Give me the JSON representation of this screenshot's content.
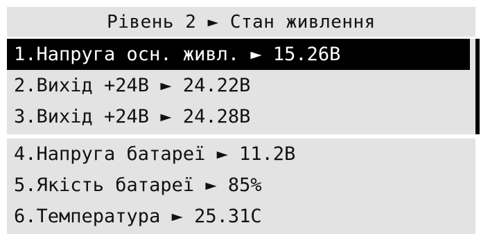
{
  "header": {
    "title": "Рівень 2 ► Стан живлення"
  },
  "menu": {
    "items": [
      {
        "label": "1.Напруга осн. живл. ► 15.26В",
        "selected": true
      },
      {
        "label": "2.Вихід +24В ► 24.22В",
        "selected": false
      },
      {
        "label": "3.Вихід +24В ► 24.28В",
        "selected": false
      },
      {
        "label": "4.Напруга батареї ► 11.2В",
        "selected": false
      },
      {
        "label": "5.Якість батареї ► 85%",
        "selected": false
      },
      {
        "label": "6.Температура ► 25.31С",
        "selected": false
      }
    ]
  },
  "colors": {
    "panel_bg": "#e3e3e3",
    "selected_bg": "#000000",
    "selected_text": "#ffffff",
    "text": "#111111"
  }
}
